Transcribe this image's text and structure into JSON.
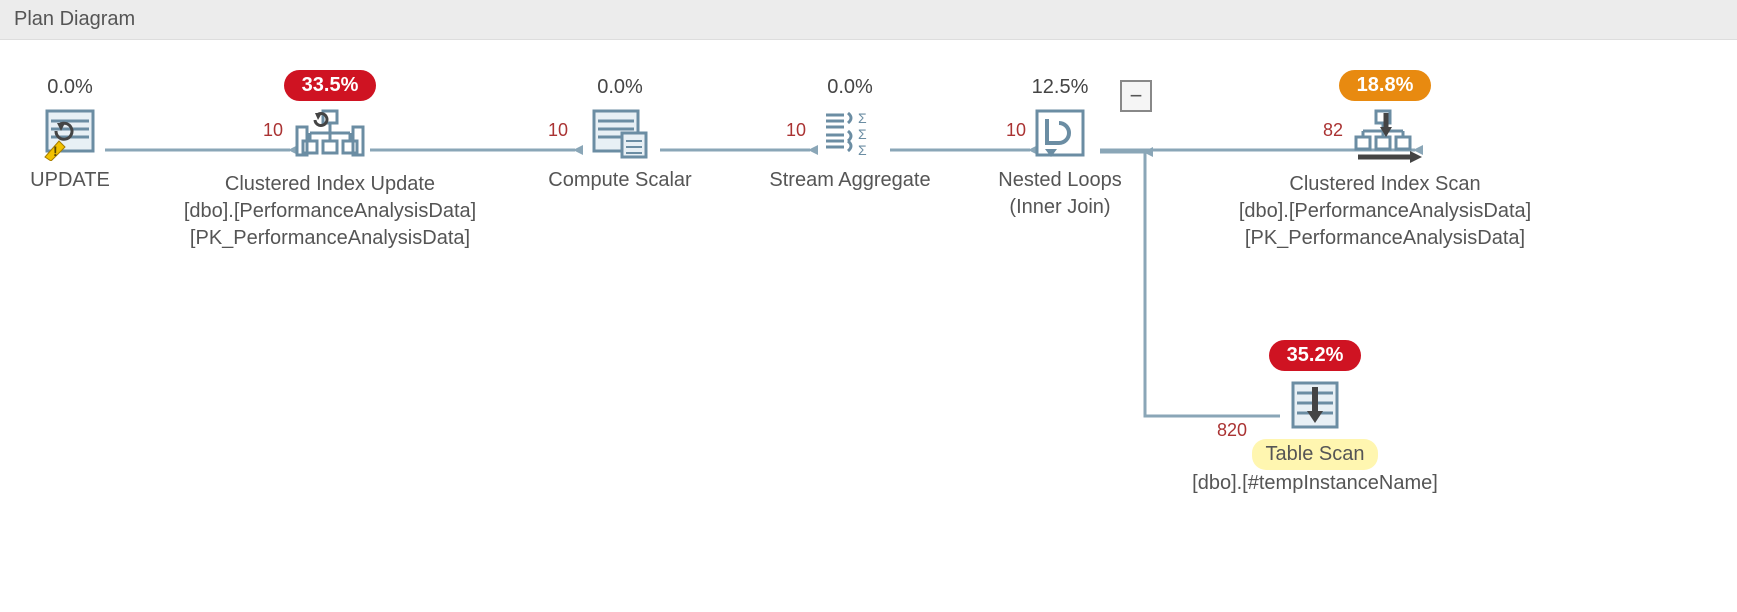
{
  "header": {
    "title": "Plan Diagram"
  },
  "nodes": {
    "update": {
      "cost": "0.0%",
      "title": "UPDATE"
    },
    "ciu": {
      "cost": "33.5%",
      "title": "Clustered Index Update",
      "det1": "[dbo].[PerformanceAnalysisData]",
      "det2": "[PK_PerformanceAnalysisData]"
    },
    "compute": {
      "cost": "0.0%",
      "title": "Compute Scalar"
    },
    "stream": {
      "cost": "0.0%",
      "title": "Stream Aggregate"
    },
    "nested": {
      "cost": "12.5%",
      "title": "Nested Loops",
      "sub": "(Inner Join)"
    },
    "cis": {
      "cost": "18.8%",
      "title": "Clustered Index Scan",
      "det1": "[dbo].[PerformanceAnalysisData]",
      "det2": "[PK_PerformanceAnalysisData]"
    },
    "tscan": {
      "cost": "35.2%",
      "title": "Table Scan",
      "det1": "[dbo].[#tempInstanceName]"
    }
  },
  "row_counts": {
    "r1": "10",
    "r2": "10",
    "r3": "10",
    "r4": "10",
    "r5": "82",
    "r6": "820"
  },
  "collapse_glyph": "−",
  "colors": {
    "accent": "#6b8da3",
    "badge_red": "#cf1322",
    "badge_orange": "#e88a10",
    "highlight": "#fff6b0"
  }
}
